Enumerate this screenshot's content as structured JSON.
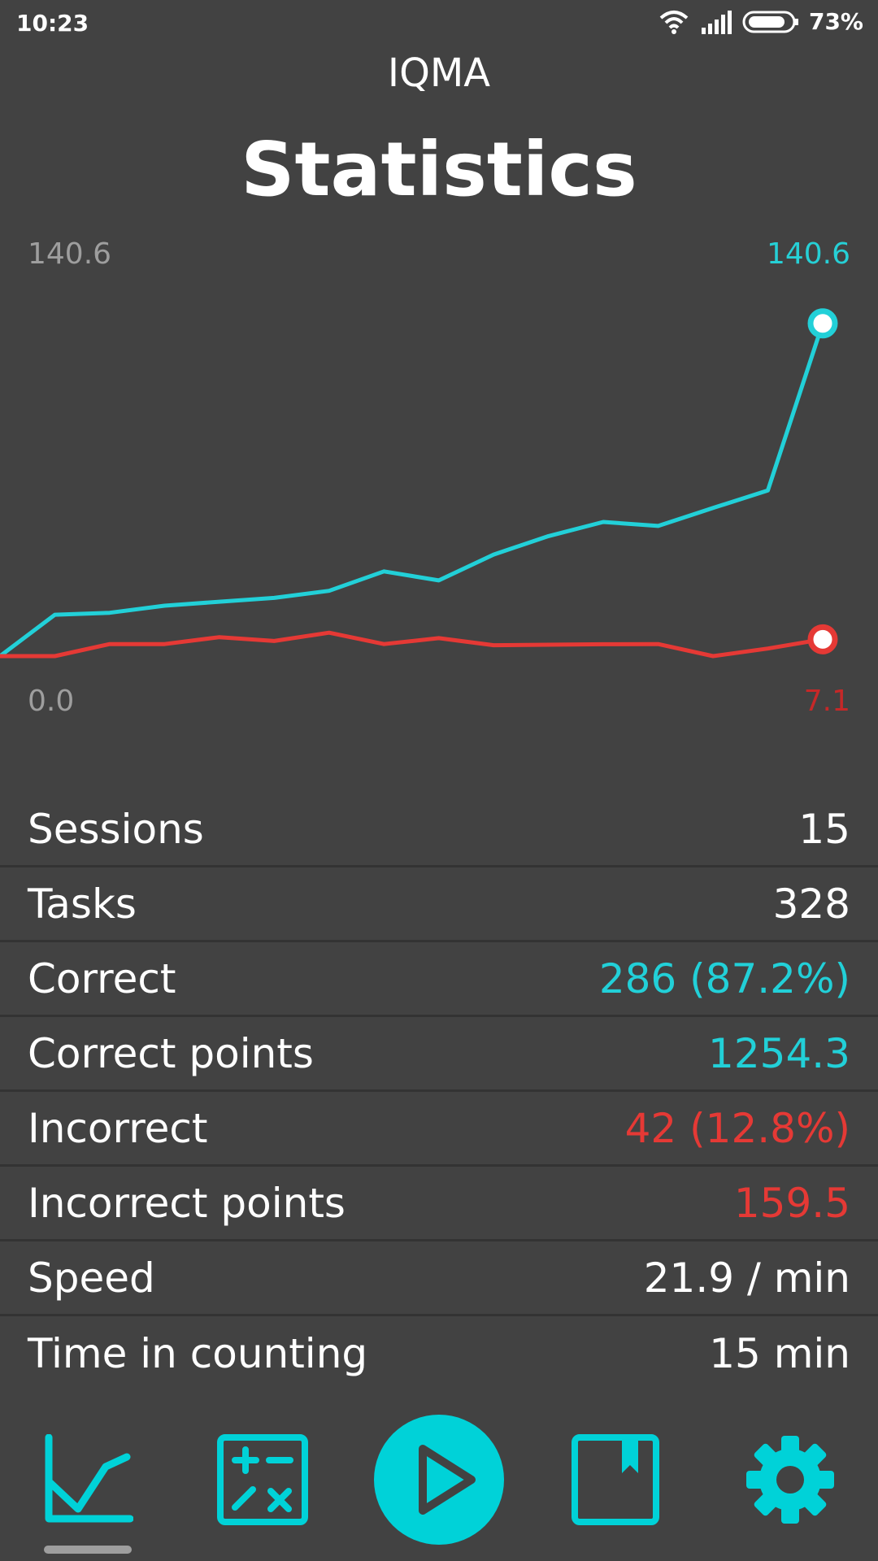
{
  "status_bar": {
    "time": "10:23",
    "battery_percent": "73%",
    "icons": [
      "wifi-icon",
      "signal-icon",
      "battery-icon"
    ]
  },
  "header": {
    "app_title": "IQMA",
    "page_title": "Statistics"
  },
  "chart_labels": {
    "top_left": "140.6",
    "top_right": "140.6",
    "bottom_left": "0.0",
    "bottom_right": "7.1"
  },
  "chart_data": {
    "type": "line",
    "title": "",
    "xlabel": "",
    "ylabel": "",
    "ylim": [
      0,
      157
    ],
    "grid": false,
    "legend": "none",
    "x": [
      0,
      1,
      2,
      3,
      4,
      5,
      6,
      7,
      8,
      9,
      10,
      11,
      12,
      13,
      14,
      15
    ],
    "series": [
      {
        "color": "#22d0d8",
        "values": [
          0,
          17.5,
          18.3,
          21.3,
          23.0,
          24.6,
          27.6,
          35.8,
          32.0,
          42.9,
          50.7,
          56.7,
          55.0,
          62.6,
          70.0,
          140.6
        ]
      },
      {
        "color": "#e53935",
        "values": [
          0,
          0,
          5.1,
          5.1,
          8.0,
          6.4,
          9.9,
          5.1,
          7.6,
          4.6,
          4.8,
          5.0,
          5.1,
          0,
          3.2,
          7.1
        ]
      }
    ]
  },
  "stats": [
    {
      "label": "Sessions",
      "value": "15",
      "color": "white"
    },
    {
      "label": "Tasks",
      "value": "328",
      "color": "white"
    },
    {
      "label": "Correct",
      "value": "286 (87.2%)",
      "color": "cyan"
    },
    {
      "label": "Correct points",
      "value": "1254.3",
      "color": "cyan"
    },
    {
      "label": "Incorrect",
      "value": "42 (12.8%)",
      "color": "red"
    },
    {
      "label": "Incorrect points",
      "value": "159.5",
      "color": "red"
    },
    {
      "label": "Speed",
      "value": "21.9 / min",
      "color": "white"
    },
    {
      "label": "Time in counting",
      "value": "15 min",
      "color": "white"
    }
  ],
  "nav": {
    "items": [
      "statistics-icon",
      "calculator-icon",
      "play-icon",
      "bookmark-icon",
      "settings-icon"
    ],
    "active": "statistics-icon",
    "accent_color": "#00d2d8"
  }
}
